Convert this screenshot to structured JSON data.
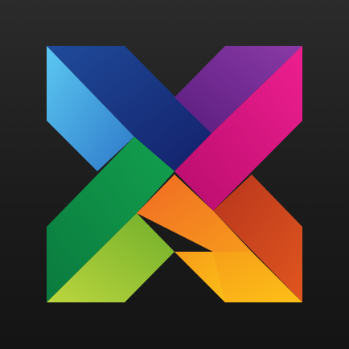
{
  "logo": {
    "icon": "multicolor-ribbon-x-logo-icon",
    "background_color": "#1f1f1f",
    "colors": {
      "light_blue": "#4fc3f0",
      "navy": "#1a2a78",
      "purple": "#7a2f9c",
      "magenta": "#e6128a",
      "green": "#0e8f4a",
      "lime": "#a5cc3a",
      "orange": "#f07a22",
      "yellow": "#fcb514",
      "dark_orange": "#c8401e"
    }
  }
}
